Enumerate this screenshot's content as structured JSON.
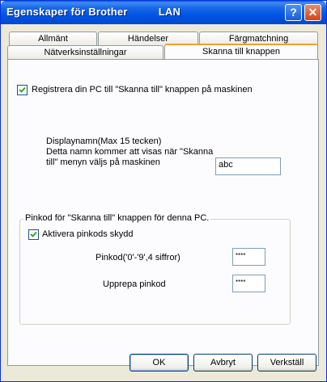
{
  "window": {
    "title": "Egenskaper för Brother          LAN",
    "help_glyph": "?",
    "close_glyph": "✕"
  },
  "tabs": {
    "row_back": [
      "Allmänt",
      "Händelser",
      "Färgmatchning"
    ],
    "row_front": [
      "Nätverksinställningar",
      "Skanna till knappen"
    ],
    "active": "Skanna till knappen"
  },
  "panel": {
    "register_checkbox": {
      "label": "Registrera din PC till \"Skanna till\" knappen på maskinen",
      "checked": true
    },
    "display_name": {
      "line1": "Displaynamn(Max 15 tecken)",
      "line2": "Detta namn kommer att visas när \"Skanna",
      "line3": "till\" menyn väljs på maskinen",
      "value": "abc"
    },
    "pin_group": {
      "title": "Pinkod för \"Skanna till\" knappen för denna PC.",
      "enable_checkbox": {
        "label": "Aktivera pinkods skydd",
        "checked": true
      },
      "pin_label": "Pinkod('0'-'9',4 siffror)",
      "pin_value": "****",
      "repeat_label": "Upprepa pinkod",
      "repeat_value": "****"
    }
  },
  "buttons": {
    "ok": "OK",
    "cancel": "Avbryt",
    "apply": "Verkställ"
  },
  "colors": {
    "title_bar": "#0055E5",
    "active_tab_accent": "#F2A02E",
    "dialog_bg": "#ECE9D8"
  }
}
